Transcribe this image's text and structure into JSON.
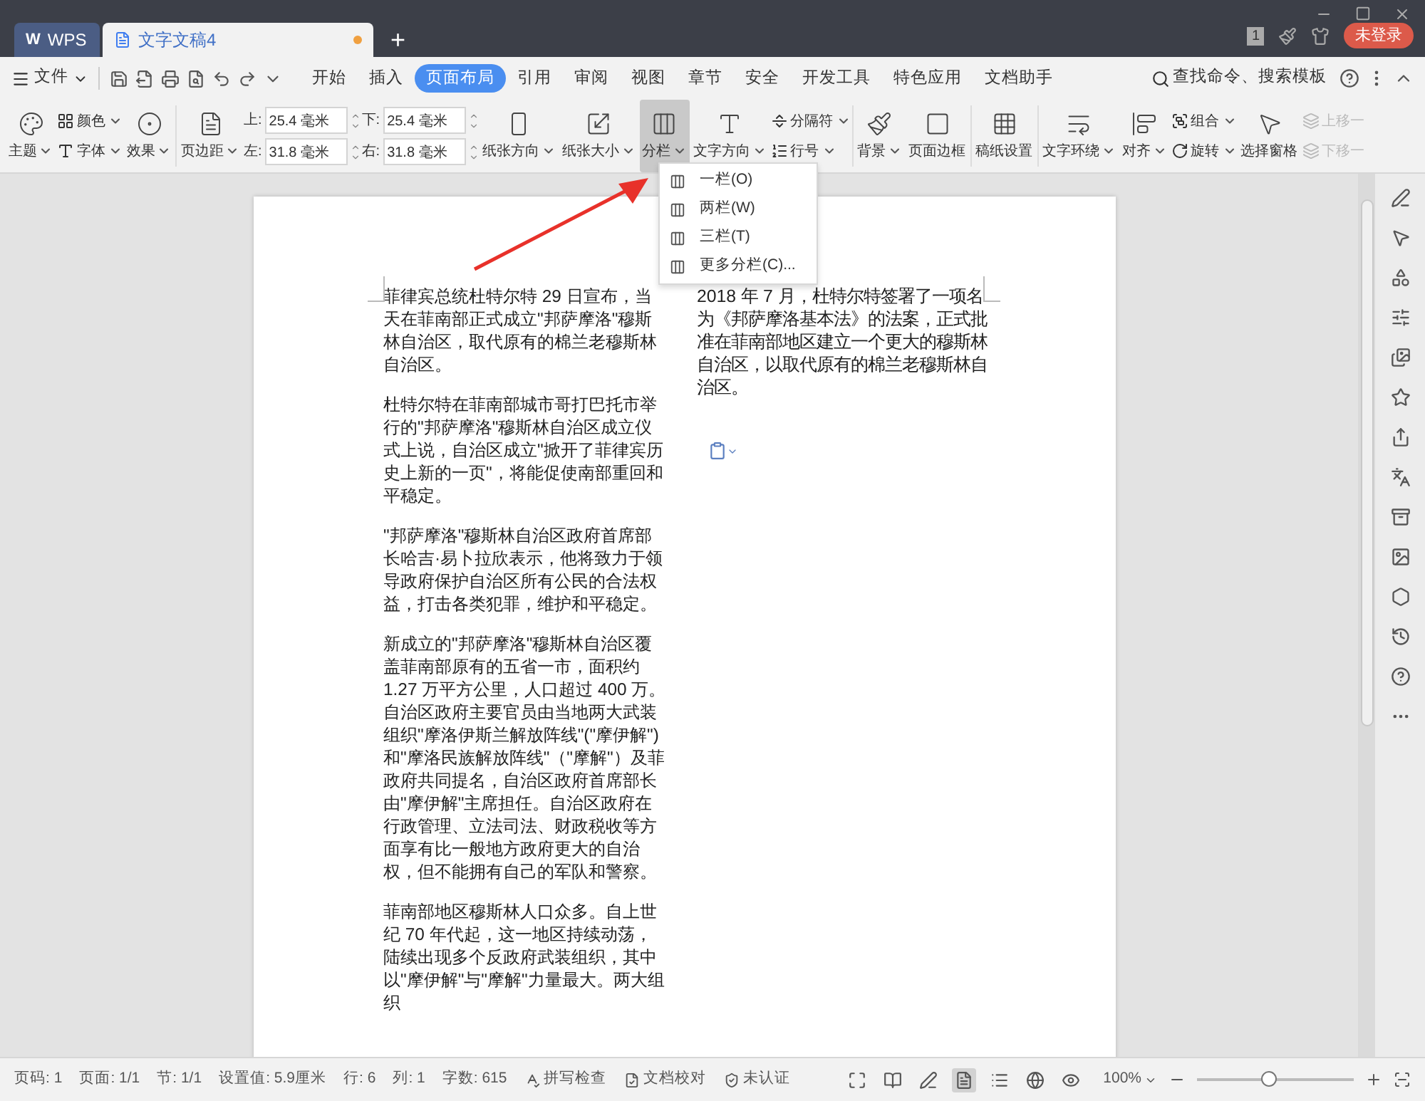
{
  "titlebar": {
    "tabs": [
      {
        "label": "WPS",
        "kind": "home",
        "logo": "W",
        "selected": false
      },
      {
        "label": "文字文稿4",
        "kind": "doc",
        "selected": true,
        "unsaved": true
      }
    ],
    "new_tab": "+",
    "badge": "1",
    "login": "未登录"
  },
  "menubar": {
    "file": "文件",
    "tabs": [
      {
        "label": "开始",
        "selected": false
      },
      {
        "label": "插入",
        "selected": false
      },
      {
        "label": "页面布局",
        "selected": true
      },
      {
        "label": "引用",
        "selected": false
      },
      {
        "label": "审阅",
        "selected": false
      },
      {
        "label": "视图",
        "selected": false
      },
      {
        "label": "章节",
        "selected": false
      },
      {
        "label": "安全",
        "selected": false
      },
      {
        "label": "开发工具",
        "selected": false
      },
      {
        "label": "特色应用",
        "selected": false
      },
      {
        "label": "文档助手",
        "selected": false
      }
    ],
    "search": "查找命令、搜索模板"
  },
  "ribbon": [
    {
      "kind": "large",
      "label": "主题",
      "dropdown": true,
      "pressed": false,
      "disabled": false
    },
    {
      "kind": "stack",
      "items": [
        {
          "label": "颜色",
          "dropdown": true,
          "disabled": false
        },
        {
          "label": "字体",
          "dropdown": true,
          "disabled": false
        }
      ]
    },
    {
      "kind": "large",
      "label": "效果",
      "dropdown": true,
      "pressed": false,
      "disabled": false
    },
    {
      "kind": "separator"
    },
    {
      "kind": "large",
      "label": "页边距",
      "dropdown": true,
      "pressed": false,
      "disabled": false
    },
    {
      "kind": "fields",
      "fields": [
        {
          "label": "上:",
          "value": "25.4 毫米"
        },
        {
          "label": "左:",
          "value": "31.8 毫米"
        }
      ]
    },
    {
      "kind": "fields",
      "fields": [
        {
          "label": "下:",
          "value": "25.4 毫米"
        },
        {
          "label": "右:",
          "value": "31.8 毫米"
        }
      ]
    },
    {
      "kind": "large",
      "label": "纸张方向",
      "dropdown": true,
      "pressed": false,
      "disabled": false
    },
    {
      "kind": "large",
      "label": "纸张大小",
      "dropdown": true,
      "pressed": false,
      "disabled": false
    },
    {
      "kind": "large",
      "label": "分栏",
      "dropdown": true,
      "pressed": true,
      "disabled": false
    },
    {
      "kind": "large",
      "label": "文字方向",
      "dropdown": true,
      "pressed": false,
      "disabled": false
    },
    {
      "kind": "stack",
      "items": [
        {
          "label": "分隔符",
          "dropdown": true,
          "disabled": false
        },
        {
          "label": "行号",
          "dropdown": true,
          "disabled": false
        }
      ]
    },
    {
      "kind": "separator"
    },
    {
      "kind": "large",
      "label": "背景",
      "dropdown": true,
      "pressed": false,
      "disabled": false
    },
    {
      "kind": "large",
      "label": "页面边框",
      "dropdown": false,
      "pressed": false,
      "disabled": false
    },
    {
      "kind": "separator"
    },
    {
      "kind": "large",
      "label": "稿纸设置",
      "dropdown": false,
      "pressed": false,
      "disabled": false
    },
    {
      "kind": "separator"
    },
    {
      "kind": "large",
      "label": "文字环绕",
      "dropdown": true,
      "pressed": false,
      "disabled": false
    },
    {
      "kind": "large",
      "label": "对齐",
      "dropdown": true,
      "pressed": false,
      "disabled": false
    },
    {
      "kind": "stack",
      "items": [
        {
          "label": "组合",
          "dropdown": true,
          "disabled": false
        },
        {
          "label": "旋转",
          "dropdown": true,
          "disabled": false
        }
      ]
    },
    {
      "kind": "large",
      "label": "选择窗格",
      "dropdown": false,
      "pressed": false,
      "disabled": false
    },
    {
      "kind": "stack",
      "items": [
        {
          "label": "上移一",
          "dropdown": false,
          "disabled": true
        },
        {
          "label": "下移一",
          "dropdown": false,
          "disabled": true
        }
      ]
    }
  ],
  "column_menu": [
    {
      "label": "一栏(O)"
    },
    {
      "label": "两栏(W)"
    },
    {
      "label": "三栏(T)"
    },
    {
      "label": "更多分栏(C)..."
    }
  ],
  "document": {
    "left_column": [
      "菲律宾总统杜特尔特 29 日宣布，当天在菲南部正式成立\"邦萨摩洛\"穆斯林自治区，取代原有的棉兰老穆斯林自治区。",
      "杜特尔特在菲南部城市哥打巴托市举行的\"邦萨摩洛\"穆斯林自治区成立仪式上说，自治区成立\"掀开了菲律宾历史上新的一页\"，将能促使南部重回和平稳定。",
      "\"邦萨摩洛\"穆斯林自治区政府首席部长哈吉·易卜拉欣表示，他将致力于领导政府保护自治区所有公民的合法权益，打击各类犯罪，维护和平稳定。",
      "新成立的\"邦萨摩洛\"穆斯林自治区覆盖菲南部原有的五省一市，面积约 1.27 万平方公里，人口超过 400 万。自治区政府主要官员由当地两大武装组织\"摩洛伊斯兰解放阵线\"(\"摩伊解\")和\"摩洛民族解放阵线\"（\"摩解\"）及菲政府共同提名，自治区政府首席部长由\"摩伊解\"主席担任。自治区政府在行政管理、立法司法、财政税收等方面享有比一般地方政府更大的自治权，但不能拥有自己的军队和警察。",
      "菲南部地区穆斯林人口众多。自上世纪 70 年代起，这一地区持续动荡，陆续出现多个反政府武装组织，其中以\"摩伊解\"与\"摩解\"力量最大。两大组织"
    ],
    "right_column": [
      "2018 年 7 月，杜特尔特签署了一项名为《邦萨摩洛基本法》的法案，正式批准在菲南部地区建立一个更大的穆斯林自治区，以取代原有的棉兰老穆斯林自治区。"
    ]
  },
  "status_bar": {
    "items": [
      "页码: 1",
      "页面: 1/1",
      "节: 1/1",
      "设置值: 5.9厘米",
      "行: 6",
      "列: 1",
      "字数: 615"
    ],
    "checks": [
      {
        "label": "拼写检查",
        "kind": "spell"
      },
      {
        "label": "文档校对",
        "kind": "proof"
      },
      {
        "label": "未认证",
        "kind": "cert"
      }
    ],
    "views": [
      {
        "selected": false
      },
      {
        "selected": false
      },
      {
        "selected": false
      },
      {
        "selected": true
      },
      {
        "selected": false
      },
      {
        "selected": false
      },
      {
        "selected": false
      }
    ],
    "zoom": "100%",
    "zoom_slider": {
      "level": 0.45
    }
  }
}
